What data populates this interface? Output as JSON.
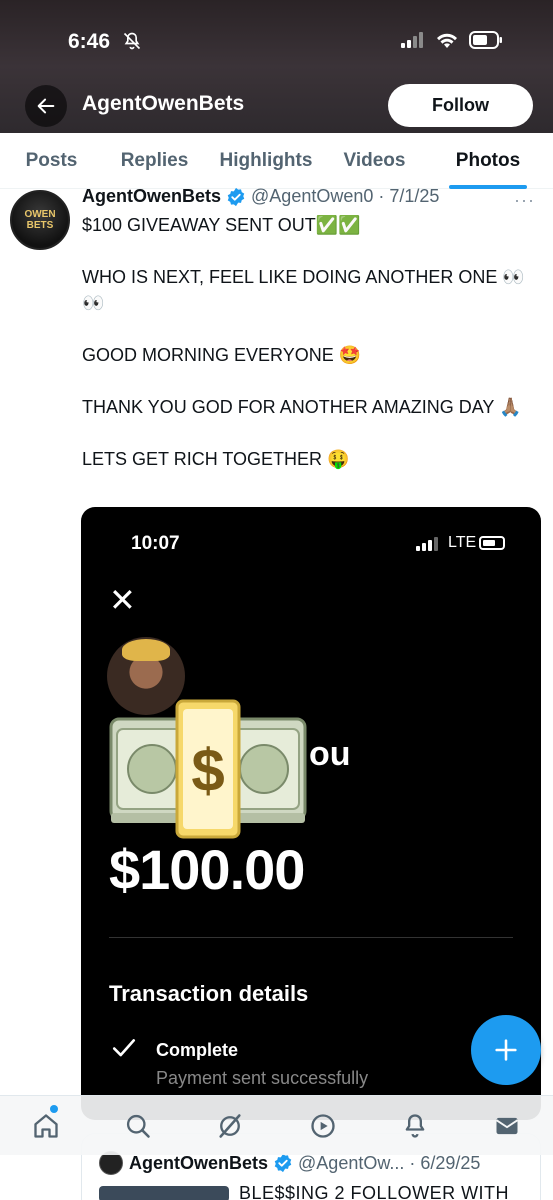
{
  "status_bar": {
    "time": "6:46"
  },
  "header": {
    "title": "AgentOwenBets",
    "follow_label": "Follow"
  },
  "tabs": [
    {
      "label": "Posts",
      "active": false
    },
    {
      "label": "Replies",
      "active": false
    },
    {
      "label": "Highlights",
      "active": false
    },
    {
      "label": "Videos",
      "active": false
    },
    {
      "label": "Photos",
      "active": true
    }
  ],
  "tweet": {
    "avatar_text": "OWEN BETS",
    "name": "AgentOwenBets",
    "handle": "@AgentOwen0 · 7/1/25",
    "more": "···",
    "paragraphs": [
      "$100 GIVEAWAY SENT OUT✅✅",
      "WHO IS NEXT, FEEL LIKE DOING ANOTHER ONE 👀👀",
      "GOOD MORNING EVERYONE 🤩",
      "THANK YOU GOD FOR ANOTHER AMAZING DAY 🙏🏽",
      "LETS GET RICH TOGETHER 🤑"
    ],
    "media": {
      "time": "10:07",
      "network": "LTE",
      "close": "✕",
      "partial_text": "ou",
      "amount": "$100.00",
      "details_title": "Transaction details",
      "status": "Complete",
      "status_sub": "Payment sent successfully"
    }
  },
  "next_tweet": {
    "name": "AgentOwenBets",
    "handle": "@AgentOw... · 6/29/25",
    "text": "BLE$$ING 2 FOLLOWER WITH"
  },
  "colors": {
    "accent": "#1d9bf0",
    "text": "#0f1419",
    "muted": "#536471"
  }
}
